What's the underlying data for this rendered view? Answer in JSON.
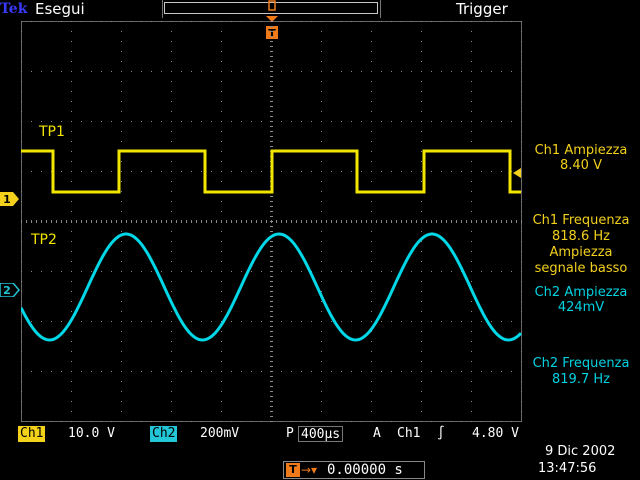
{
  "toolbar": {
    "brand": "Tek",
    "run_state": "Esegui",
    "trigger_mode": "Trigger"
  },
  "markers": {
    "trigger_top": "T",
    "trigger_position": "T",
    "ch1": "1",
    "ch2": "2"
  },
  "traces": {
    "ch1_label": "TP1",
    "ch2_label": "TP2",
    "ch1_color": "#f2e600",
    "ch2_color": "#00d8e8"
  },
  "measurements": {
    "ch1_amplitude_title": "Ch1 Ampiezza",
    "ch1_amplitude_value": "8.40 V",
    "ch1_frequency_title": "Ch1 Frequenza",
    "ch1_frequency_value": "818.6 Hz",
    "ch1_frequency_note_1": "Ampiezza",
    "ch1_frequency_note_2": "segnale basso",
    "ch2_amplitude_title": "Ch2 Ampiezza",
    "ch2_amplitude_value": "424mV",
    "ch2_frequency_title": "Ch2 Frequenza",
    "ch2_frequency_value": "819.7 Hz"
  },
  "statusbar": {
    "ch1_label": "Ch1",
    "ch1_scale": "10.0 V",
    "ch2_label": "Ch2",
    "ch2_scale": "200mV",
    "timebase_label": "P",
    "timebase_value": "400µs",
    "trigger_label": "A",
    "trigger_source": "Ch1",
    "trigger_slope": "∫",
    "trigger_level": "4.80 V"
  },
  "trigger_position": {
    "arrow": "→▾",
    "value": "0.00000 s"
  },
  "datetime": {
    "date": "9 Dic  2002",
    "time": "13:47:56"
  }
}
